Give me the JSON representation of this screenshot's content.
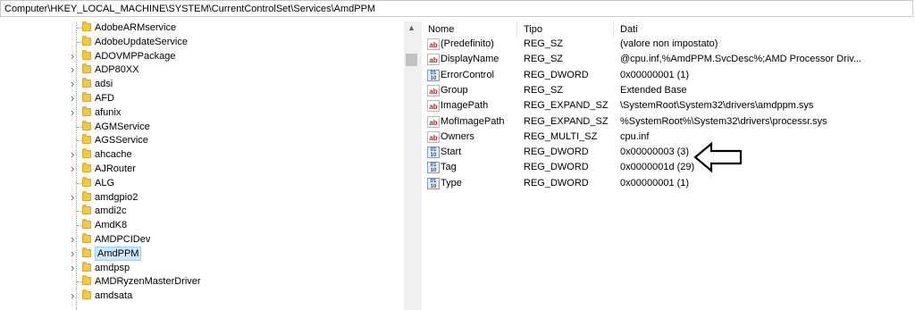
{
  "address": {
    "path": "Computer\\HKEY_LOCAL_MACHINE\\SYSTEM\\CurrentControlSet\\Services\\AmdPPM"
  },
  "tree": {
    "items": [
      {
        "label": "AdobeARMservice",
        "expandable": false,
        "selected": false
      },
      {
        "label": "AdobeUpdateService",
        "expandable": false,
        "selected": false
      },
      {
        "label": "ADOVMPPackage",
        "expandable": true,
        "selected": false
      },
      {
        "label": "ADP80XX",
        "expandable": true,
        "selected": false
      },
      {
        "label": "adsi",
        "expandable": true,
        "selected": false
      },
      {
        "label": "AFD",
        "expandable": true,
        "selected": false
      },
      {
        "label": "afunix",
        "expandable": true,
        "selected": false
      },
      {
        "label": "AGMService",
        "expandable": false,
        "selected": false
      },
      {
        "label": "AGSService",
        "expandable": false,
        "selected": false
      },
      {
        "label": "ahcache",
        "expandable": true,
        "selected": false
      },
      {
        "label": "AJRouter",
        "expandable": true,
        "selected": false
      },
      {
        "label": "ALG",
        "expandable": false,
        "selected": false
      },
      {
        "label": "amdgpio2",
        "expandable": true,
        "selected": false
      },
      {
        "label": "amdi2c",
        "expandable": false,
        "selected": false
      },
      {
        "label": "AmdK8",
        "expandable": false,
        "selected": false
      },
      {
        "label": "AMDPCIDev",
        "expandable": true,
        "selected": false
      },
      {
        "label": "AmdPPM",
        "expandable": true,
        "selected": true
      },
      {
        "label": "amdpsp",
        "expandable": true,
        "selected": false
      },
      {
        "label": "AMDRyzenMasterDriver",
        "expandable": false,
        "selected": false
      },
      {
        "label": "amdsata",
        "expandable": true,
        "selected": false
      }
    ]
  },
  "list": {
    "columns": {
      "name": "Nome",
      "type": "Tipo",
      "data": "Dati"
    },
    "rows": [
      {
        "icon": "string-value-icon",
        "name": "(Predefinito)",
        "type": "REG_SZ",
        "data": "(valore non impostato)"
      },
      {
        "icon": "string-value-icon",
        "name": "DisplayName",
        "type": "REG_SZ",
        "data": "@cpu.inf,%AmdPPM.SvcDesc%;AMD Processor Driv..."
      },
      {
        "icon": "binary-value-icon",
        "name": "ErrorControl",
        "type": "REG_DWORD",
        "data": "0x00000001 (1)"
      },
      {
        "icon": "string-value-icon",
        "name": "Group",
        "type": "REG_SZ",
        "data": "Extended Base"
      },
      {
        "icon": "string-value-icon",
        "name": "ImagePath",
        "type": "REG_EXPAND_SZ",
        "data": "\\SystemRoot\\System32\\drivers\\amdppm.sys"
      },
      {
        "icon": "string-value-icon",
        "name": "MofImagePath",
        "type": "REG_EXPAND_SZ",
        "data": "%SystemRoot%\\System32\\drivers\\processr.sys"
      },
      {
        "icon": "string-value-icon",
        "name": "Owners",
        "type": "REG_MULTI_SZ",
        "data": "cpu.inf"
      },
      {
        "icon": "binary-value-icon",
        "name": "Start",
        "type": "REG_DWORD",
        "data": "0x00000003 (3)"
      },
      {
        "icon": "binary-value-icon",
        "name": "Tag",
        "type": "REG_DWORD",
        "data": "0x0000001d (29)"
      },
      {
        "icon": "binary-value-icon",
        "name": "Type",
        "type": "REG_DWORD",
        "data": "0x00000001 (1)"
      }
    ]
  },
  "colors": {
    "selection": "#cce8ff",
    "folder": "#f3c84a",
    "string_icon": "#c21a1a",
    "binary_icon": "#1f4fa8"
  }
}
